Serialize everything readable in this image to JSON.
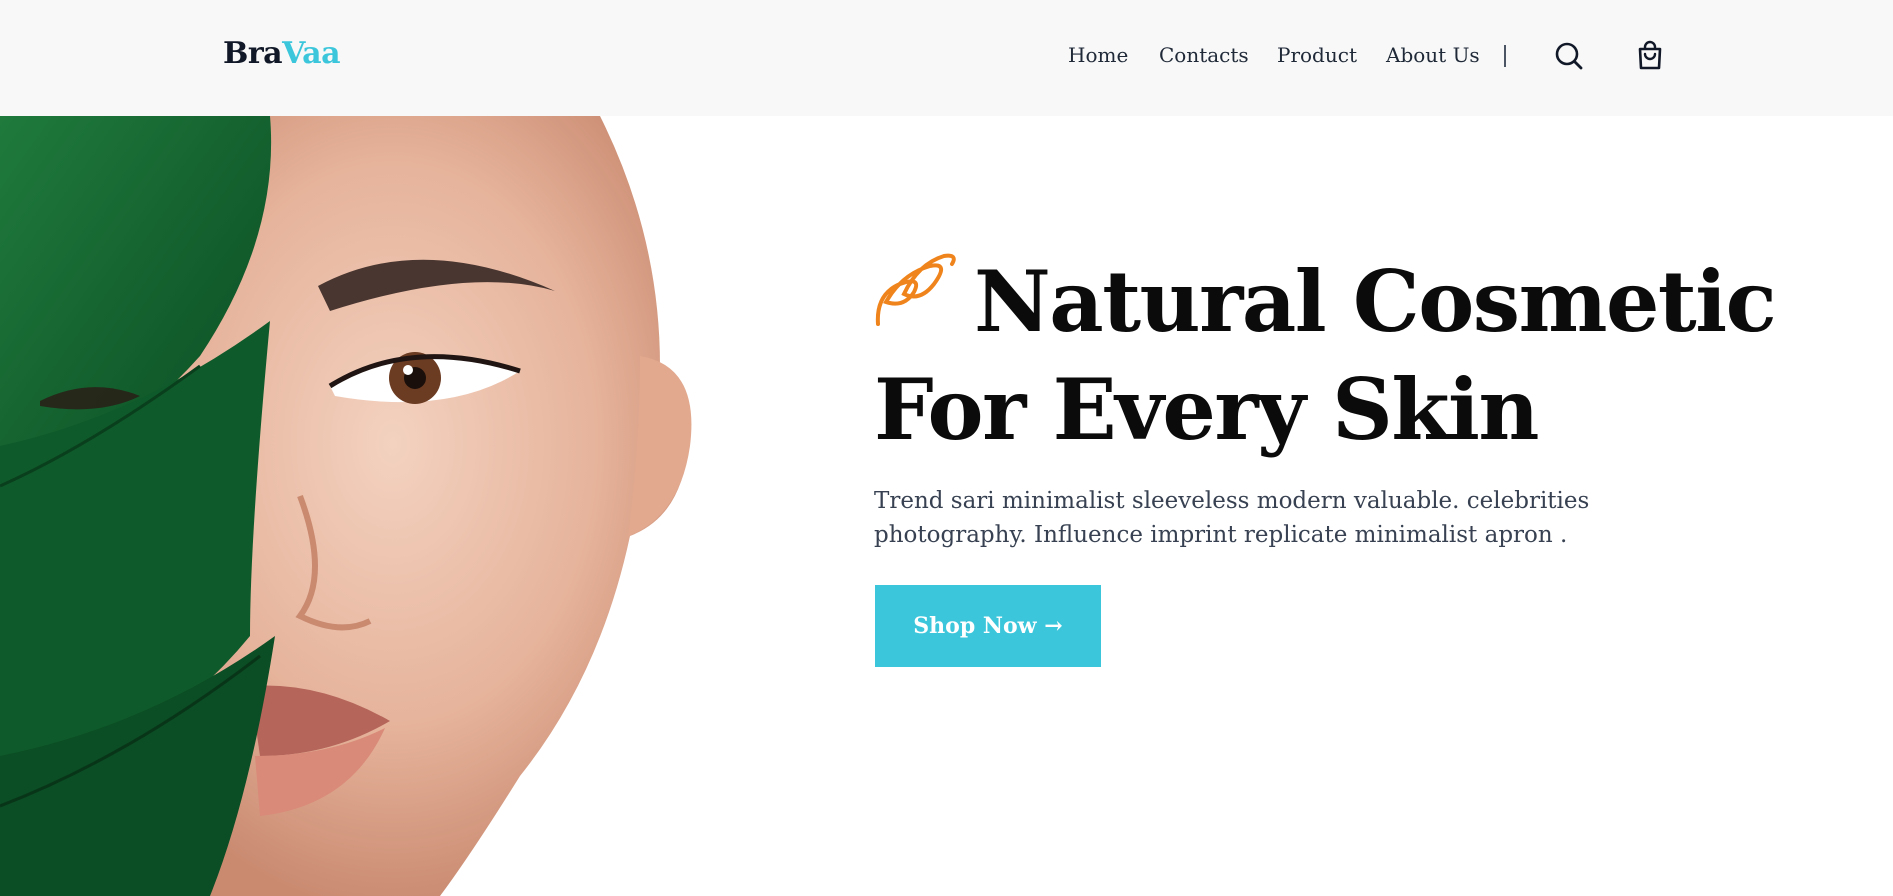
{
  "brand": {
    "name_part1": "Bra",
    "name_part2": "Vaa",
    "accent_color": "#3cc6db"
  },
  "nav": {
    "items": [
      {
        "label": "Home"
      },
      {
        "label": "Contacts"
      },
      {
        "label": "Product"
      },
      {
        "label": "About Us"
      }
    ],
    "separator": "|",
    "search_icon": "search-icon",
    "cart_icon": "shopping-bag-icon"
  },
  "hero": {
    "headline_line1": "Natural Cosmetic",
    "headline_line2": "For Every Skin",
    "description": "Trend sari minimalist sleeveless modern valuable. celebrities photography. Influence imprint replicate minimalist apron .",
    "cta_label": "Shop Now →",
    "swirl_color": "#f0841c",
    "image_icon": "woman-with-green-leaf-photo"
  },
  "colors": {
    "header_bg": "#f8f8f8",
    "button_bg": "#3cc6db",
    "text_dark": "#0b0b0b"
  }
}
